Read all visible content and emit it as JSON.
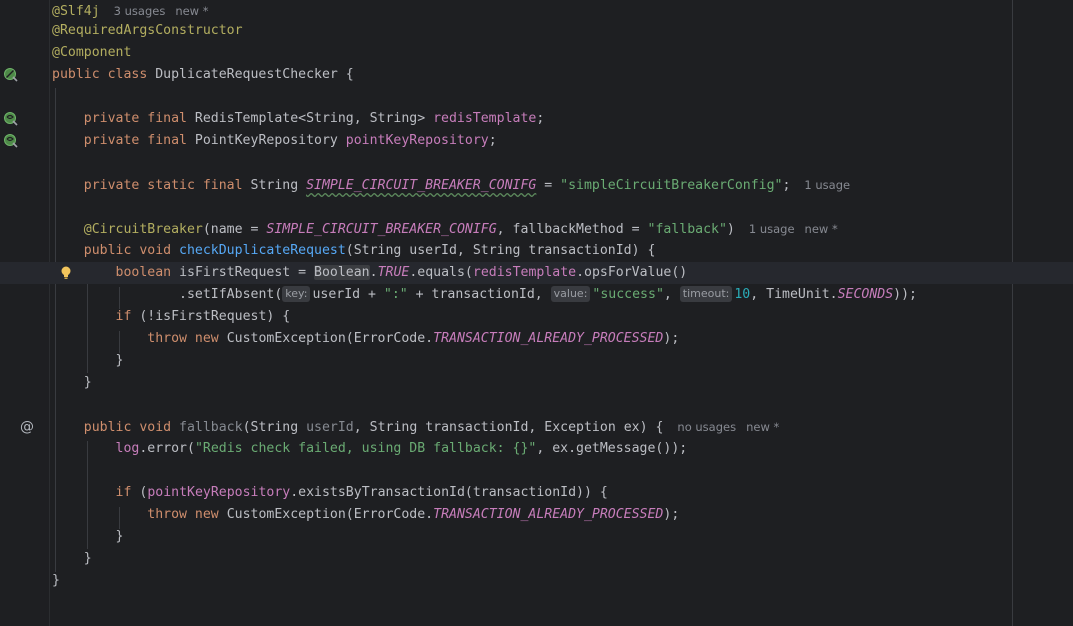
{
  "editor": {
    "theme_colors": {
      "background": "#1e1f22",
      "keyword": "#cf8e6d",
      "annotation": "#b3ae60",
      "field": "#c77dbb",
      "string": "#6aab73",
      "number": "#2aacb8",
      "method": "#56a8f5",
      "text": "#bcbec4",
      "hint": "#878a92"
    },
    "gutter_icons": [
      "bean-class-icon",
      "bean-field-icon",
      "bean-field-icon",
      "implements-at-icon",
      "lightbulb-icon"
    ]
  },
  "code": {
    "l1": {
      "ann": "@Slf4j",
      "hint_usages": "3 usages",
      "hint_new": "new *"
    },
    "l2": {
      "ann": "@RequiredArgsConstructor"
    },
    "l3": {
      "ann": "@Component"
    },
    "l4": {
      "kw": "public class ",
      "name": "DuplicateRequestChecker {"
    },
    "l6": {
      "kw": "private final ",
      "type": "RedisTemplate<String, String> ",
      "field": "redisTemplate",
      "end": ";"
    },
    "l7": {
      "kw": "private final ",
      "type": "PointKeyRepository ",
      "field": "pointKeyRepository",
      "end": ";"
    },
    "l9": {
      "kw": "private static final ",
      "type": "String ",
      "const": "SIMPLE_CIRCUIT_BREAKER_CONIFG",
      "eq": " = ",
      "str": "\"simpleCircuitBreakerConfig\"",
      "end": ";",
      "hint_usage": "1 usage"
    },
    "l11": {
      "ann": "@CircuitBreaker",
      "p1": "(name = ",
      "const": "SIMPLE_CIRCUIT_BREAKER_CONIFG",
      "p2": ", fallbackMethod = ",
      "str": "\"fallback\"",
      "end": ")",
      "hint_usage": "1 usage",
      "hint_new": "new *"
    },
    "l12": {
      "kw": "public void ",
      "method": "checkDuplicateRequest",
      "params": "(String userId, String transactionId) {"
    },
    "l13": {
      "kw": "boolean ",
      "var": "isFirstRequest = ",
      "cls": "Boolean",
      "dot": ".",
      "const": "TRUE",
      "call1": ".equals(",
      "field": "redisTemplate",
      "call2": ".opsForValue()"
    },
    "l14": {
      "call": ".setIfAbsent(",
      "hint_key": "key:",
      "arg1": "userId + ",
      "str1": "\":\"",
      "arg2": " + transactionId, ",
      "hint_value": "value:",
      "str2": "\"success\"",
      "sep": ", ",
      "hint_timeout": "timeout:",
      "num": "10",
      "arg3": ", TimeUnit.",
      "const": "SECONDS",
      "end": "));"
    },
    "l15": {
      "kw": "if ",
      "rest": "(!isFirstRequest) {"
    },
    "l16": {
      "kw": "throw new ",
      "rest": "CustomException(ErrorCode.",
      "const": "TRANSACTION_ALREADY_PROCESSED",
      "end": ");"
    },
    "l17": {
      "text": "}"
    },
    "l18": {
      "text": "}"
    },
    "l20": {
      "kw": "public void ",
      "method": "fallback",
      "p1": "(String ",
      "unused": "userId",
      "p2": ", String transactionId, Exception ex) {",
      "hint_usages": "no usages",
      "hint_new": "new *"
    },
    "l21": {
      "field": "log",
      "call": ".error(",
      "str": "\"Redis check failed, using DB fallback: {}\"",
      "rest": ", ex.getMessage());"
    },
    "l23": {
      "kw": "if ",
      "p1": "(",
      "field": "pointKeyRepository",
      "rest": ".existsByTransactionId(transactionId)) {"
    },
    "l24": {
      "kw": "throw new ",
      "rest": "CustomException(ErrorCode.",
      "const": "TRANSACTION_ALREADY_PROCESSED",
      "end": ");"
    },
    "l25": {
      "text": "}"
    },
    "l26": {
      "text": "}"
    },
    "l27": {
      "text": "}"
    }
  }
}
